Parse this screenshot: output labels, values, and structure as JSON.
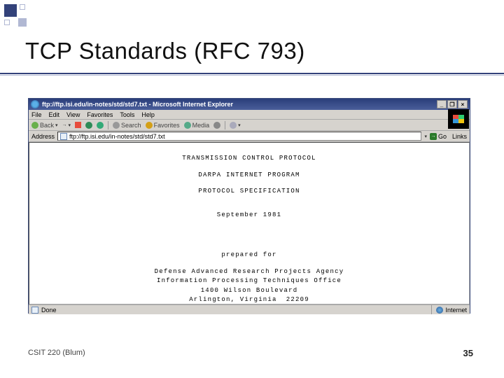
{
  "slide": {
    "title": "TCP Standards (RFC 793)",
    "footer_left": "CSIT 220 (Blum)",
    "page_number": "35"
  },
  "browser": {
    "window_title": "ftp://ftp.isi.edu/in-notes/std/std7.txt - Microsoft Internet Explorer",
    "menu": {
      "file": "File",
      "edit": "Edit",
      "view": "View",
      "favorites": "Favorites",
      "tools": "Tools",
      "help": "Help"
    },
    "toolbar": {
      "back": "Back",
      "search": "Search",
      "favorites": "Favorites",
      "media": "Media"
    },
    "address": {
      "label": "Address",
      "value": "ftp://ftp.isi.edu/in-notes/std/std7.txt",
      "go": "Go",
      "links": "Links"
    },
    "status": {
      "done": "Done",
      "zone": "Internet"
    }
  },
  "document": {
    "line1": "TRANSMISSION CONTROL PROTOCOL",
    "line2": "DARPA INTERNET PROGRAM",
    "line3": "PROTOCOL SPECIFICATION",
    "line4": "September 1981",
    "line5": "prepared for",
    "line6": "Defense Advanced Research Projects Agency",
    "line7": "Information Processing Techniques Office",
    "line8": "1400 Wilson Boulevard",
    "line9": "Arlington, Virginia  22209"
  }
}
